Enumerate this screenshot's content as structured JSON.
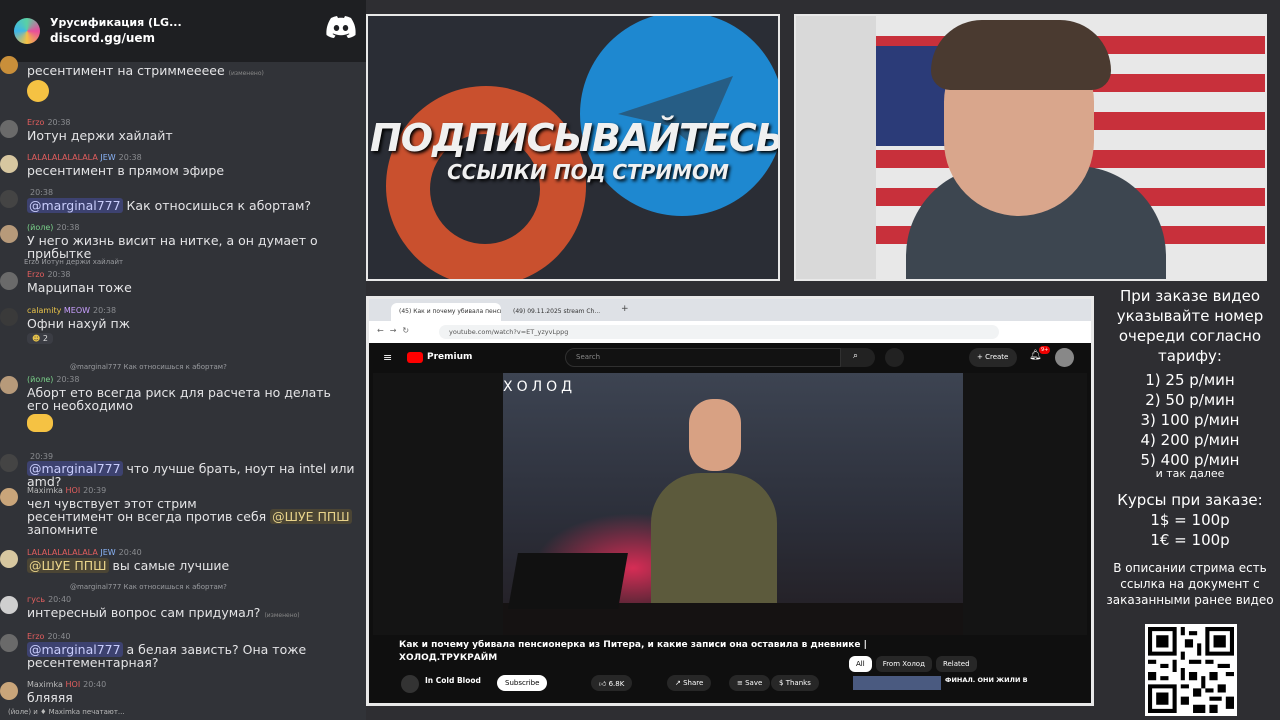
{
  "chat": {
    "server_name": "Урусификация (LG...",
    "server_link": "discord.gg/uem",
    "messages": [
      {
        "text": "ресентимент на стриммеееее",
        "edited": "(изменено)"
      },
      {
        "name": "Erzo",
        "time": "20:38",
        "text": "Иотун держи хайлайт"
      },
      {
        "name": "LALALALALALALA",
        "badge": "JEW",
        "time": "20:38",
        "text": "ресентимент в прямом эфире"
      },
      {
        "time": "20:38",
        "mention": "@marginal777",
        "text": " Как относишься к абортам?"
      },
      {
        "name": "(йоле)",
        "time": "20:38",
        "text": "У него жизнь висит на нитке, а он думает о прибытке"
      },
      {
        "reply": "Erzo Иотун держи хайлайт",
        "name": "Erzo",
        "time": "20:38",
        "text": "Марципан тоже"
      },
      {
        "name": "calamity",
        "badge": "MEOW",
        "time": "20:38",
        "text": "Офни нахуй пж",
        "reaction": "2"
      },
      {
        "reply": "@marginal777 Как относишься к абортам?",
        "name": "(йоле)",
        "time": "20:38",
        "text": "Аборт ето всегда риск для расчета но делать его необходимо"
      },
      {
        "time": "20:39",
        "mention": "@marginal777",
        "text": " что лучше брать, ноут на intel или amd?"
      },
      {
        "name": "Maximka",
        "badge": "HOI",
        "time": "20:39",
        "text": "чел чувствует этот стрим",
        "text2": "ресентимент он всегда против себя ",
        "mention2": "@ШУЕ ППШ",
        "text3": "запомните"
      },
      {
        "name": "LALALALALALALA",
        "badge": "JEW",
        "time": "20:40",
        "mention": "@ШУЕ ППШ",
        "text": " вы самые лучшие"
      },
      {
        "reply": "@marginal777 Как относишься к абортам?",
        "name": "гусь",
        "time": "20:40",
        "text": "интересный вопрос сам придумал?",
        "edited": "(изменено)"
      },
      {
        "name": "Erzo",
        "time": "20:40",
        "mention": "@marginal777",
        "text": " а белая зависть? Она тоже ресентементарная?"
      },
      {
        "name": "Maximka",
        "badge": "HOI",
        "time": "20:40",
        "text": "бляяяя"
      }
    ],
    "typing": "(йоле) и ♦ Maximka печатают..."
  },
  "promo": {
    "line1": "ПОДПИСЫВАЙТЕСЬ",
    "line2": "ССЫЛКИ ПОД СТРИМОМ"
  },
  "browser": {
    "tab1": "(45) Как и почему убивала пенсио...",
    "tab2": "(49) 09.11.2025 stream Ch...",
    "url": "youtube.com/watch?v=ET_yzyvLppg",
    "premium": "Premium",
    "search_placeholder": "Search",
    "create": "Create",
    "notif_count": "9+",
    "watermark": "ХОЛОД",
    "video_title": "Как и почему убивала пенсионерка из Питера, и какие записи она оставила в дневнике | ХОЛОД.ТРУКРАЙМ",
    "chips": [
      "All",
      "From Холод",
      "Related"
    ],
    "channel": "In Cold Blood",
    "subscribe": "Subscribe",
    "likes": "6.8K",
    "share": "Share",
    "save": "Save",
    "thanks": "Thanks",
    "related": "ФИНАЛ. ОНИ ЖИЛИ В"
  },
  "info": {
    "intro": "При заказе видео указывайте номер очереди согласно тарифу:",
    "tariffs": [
      "1) 25 р/мин",
      "2) 50 р/мин",
      "3) 100 р/мин",
      "4) 200 р/мин",
      "5) 400 р/мин"
    ],
    "etc": "и так далее",
    "courses_title": "Курсы при заказе:",
    "courses": [
      "1$ = 100р",
      "1€ = 100р"
    ],
    "note": "В описании стрима есть ссылка на документ с заказанными ранее видео"
  },
  "colors": {
    "discord": "#5865f2",
    "youtube": "#ff0000",
    "promo_orange": "#c9502e",
    "promo_blue": "#1e88d0"
  }
}
